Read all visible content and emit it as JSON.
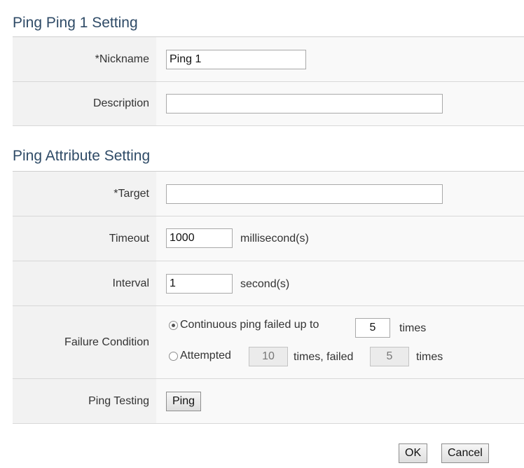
{
  "section1": {
    "title": "Ping Ping 1 Setting",
    "nickname_label": "*Nickname",
    "nickname_value": "Ping 1",
    "description_label": "Description",
    "description_value": ""
  },
  "section2": {
    "title": "Ping Attribute Setting",
    "target_label": "*Target",
    "target_value": "",
    "timeout_label": "Timeout",
    "timeout_value": "1000",
    "timeout_unit": "millisecond(s)",
    "interval_label": "Interval",
    "interval_value": "1",
    "interval_unit": "second(s)",
    "failure_label": "Failure Condition",
    "option1": {
      "selected": true,
      "text_before": "Continuous ping failed up to",
      "value": "5",
      "text_after": "times"
    },
    "option2": {
      "selected": false,
      "text_before": "Attempted",
      "attempts_value": "10",
      "text_middle": "times, failed",
      "failed_value": "5",
      "text_after": "times"
    },
    "ping_testing_label": "Ping Testing",
    "ping_button": "Ping"
  },
  "footer": {
    "ok_button": "OK",
    "cancel_button": "Cancel"
  }
}
